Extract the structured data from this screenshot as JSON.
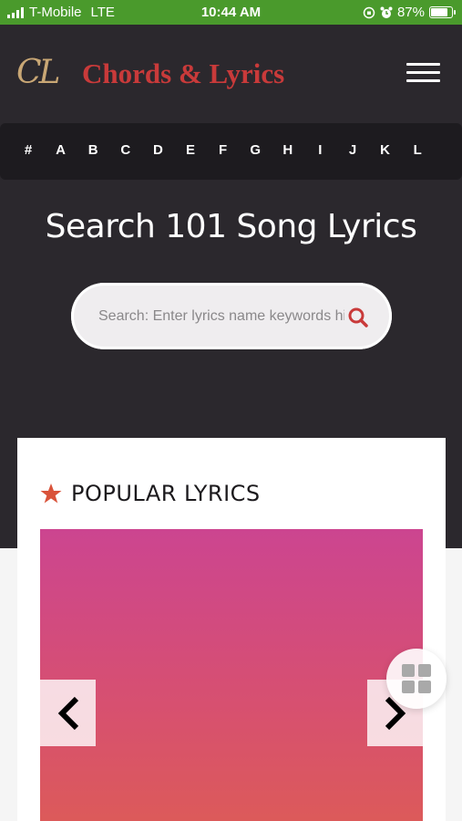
{
  "status_bar": {
    "carrier": "T-Mobile",
    "network": "LTE",
    "time": "10:44 AM",
    "battery_percent": "87%",
    "battery_level": 0.87
  },
  "header": {
    "logo_mark": "CL",
    "logo_text": "Chords & Lyrics",
    "menu_icon": "hamburger-icon"
  },
  "alphabet": [
    "#",
    "A",
    "B",
    "C",
    "D",
    "E",
    "F",
    "G",
    "H",
    "I",
    "J",
    "K",
    "L"
  ],
  "hero": {
    "title": "Search 101 Song Lyrics",
    "search_placeholder": "Search: Enter lyrics name keywords hit enter",
    "search_icon": "search-icon"
  },
  "popular": {
    "title": "POPULAR LYRICS",
    "title_icon": "star-icon",
    "prev_icon": "chevron-left-icon",
    "next_icon": "chevron-right-icon"
  },
  "colors": {
    "status_bar": "#4a9a2c",
    "brand_red": "#c93a3a",
    "logo_gold": "#c9a775",
    "dark_bg": "#2b282d",
    "accent_star": "#d9533a"
  },
  "fab_icon": "grid-icon"
}
